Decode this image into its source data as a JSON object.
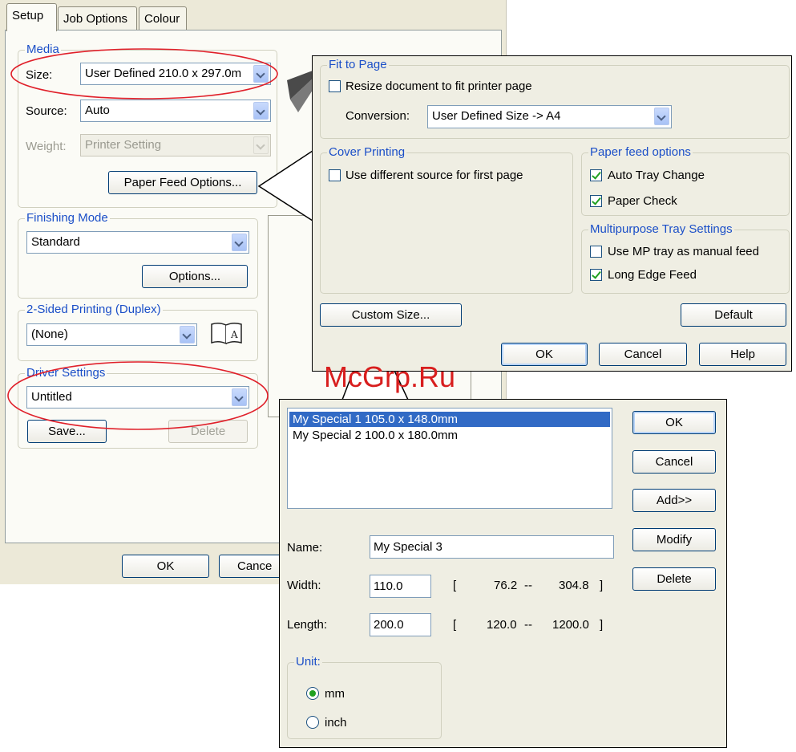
{
  "tabs": [
    "Setup",
    "Job Options",
    "Colour"
  ],
  "media": {
    "label": "Media",
    "size_label": "Size:",
    "size_value": "User Defined 210.0 x 297.0m",
    "source_label": "Source:",
    "source_value": "Auto",
    "weight_label": "Weight:",
    "weight_value": "Printer Setting",
    "paper_feed_btn": "Paper Feed Options..."
  },
  "finishing": {
    "label": "Finishing Mode",
    "value": "Standard",
    "options_btn": "Options..."
  },
  "duplex": {
    "label": "2-Sided Printing (Duplex)",
    "value": "(None)"
  },
  "driver": {
    "label": "Driver Settings",
    "value": "Untitled",
    "save_btn": "Save...",
    "delete_btn": "Delete"
  },
  "main_footer": {
    "ok": "OK",
    "cancel": "Cance"
  },
  "paper_feed": {
    "fit": {
      "label": "Fit to Page",
      "resize_label": "Resize document to fit printer page",
      "resize_checked": false,
      "conversion_label": "Conversion:",
      "conversion_value": "User Defined Size -> A4"
    },
    "cover": {
      "label": "Cover Printing",
      "diff_source_label": "Use different source for first page",
      "diff_source_checked": false
    },
    "feed_options": {
      "label": "Paper feed options",
      "auto_tray_label": "Auto Tray Change",
      "auto_tray_checked": true,
      "paper_check_label": "Paper Check",
      "paper_check_checked": true
    },
    "mp_tray": {
      "label": "Multipurpose Tray Settings",
      "manual_label": "Use MP tray as manual feed",
      "manual_checked": false,
      "long_edge_label": "Long Edge Feed",
      "long_edge_checked": true
    },
    "custom_size_btn": "Custom Size...",
    "default_btn": "Default",
    "ok": "OK",
    "cancel": "Cancel",
    "help": "Help"
  },
  "watermark": "McGrp.Ru",
  "custom_size": {
    "list": [
      "My Special 1 105.0 x 148.0mm",
      "My Special 2 100.0 x 180.0mm"
    ],
    "selected_index": 0,
    "ok": "OK",
    "cancel": "Cancel",
    "add": "Add>>",
    "modify": "Modify",
    "delete": "Delete",
    "name_label": "Name:",
    "name_value": "My Special 3",
    "width_label": "Width:",
    "width_value": "110.0",
    "width_min": "76.2",
    "width_max": "304.8",
    "length_label": "Length:",
    "length_value": "200.0",
    "length_min": "120.0",
    "length_max": "1200.0",
    "range_open": "[",
    "range_sep": "--",
    "range_close": "]",
    "unit": {
      "label": "Unit:",
      "mm": "mm",
      "inch": "inch",
      "selected": "mm"
    }
  },
  "colors": {
    "group_label": "#1b4fc8",
    "highlight_oval": "#e0202a",
    "selection": "#316ac5",
    "watermark": "#d81e1e"
  }
}
